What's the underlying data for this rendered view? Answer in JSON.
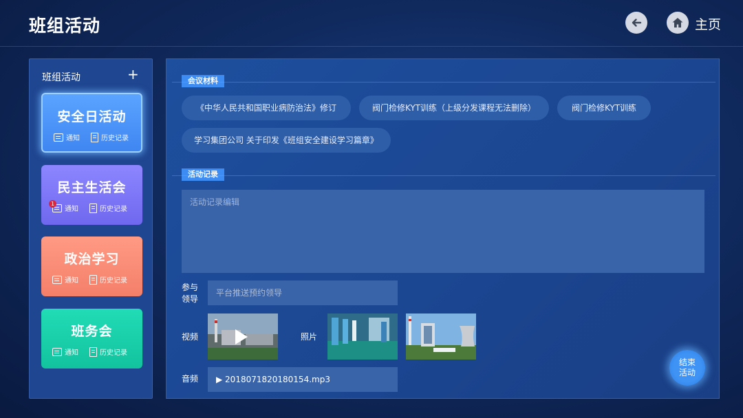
{
  "header": {
    "title": "班组活动",
    "home_label": "主页"
  },
  "sidebar": {
    "title": "班组活动",
    "add_symbol": "+",
    "cards": [
      {
        "title": "安全日活动",
        "notice": "通知",
        "history": "历史记录",
        "badge": ""
      },
      {
        "title": "民主生活会",
        "notice": "通知",
        "history": "历史记录",
        "badge": "1"
      },
      {
        "title": "政治学习",
        "notice": "通知",
        "history": "历史记录",
        "badge": ""
      },
      {
        "title": "班务会",
        "notice": "通知",
        "history": "历史记录",
        "badge": ""
      }
    ]
  },
  "main": {
    "materials_tag": "会议材料",
    "materials": [
      "《中华人民共和国职业病防治法》修订",
      "阀门检修KYT训练（上级分发课程无法删除）",
      "阀门检修KYT训练",
      "学习集团公司 关于印发《班组安全建设学习篇章》"
    ],
    "record_tag": "活动记录",
    "record_placeholder": "活动记录编辑",
    "leader_label": "参与\n领导",
    "leader_placeholder": "平台推送预约领导",
    "video_label": "视频",
    "photo_label": "照片",
    "audio_label": "音频",
    "audio_file": "▶ 2018071820180154.mp3",
    "end_button": "结束活动"
  },
  "colors": {
    "accent": "#3c8cf3",
    "card_safety": "#4f97fb",
    "card_democratic": "#7f78f8",
    "card_political": "#f98d77",
    "card_team": "#18cfaa",
    "badge": "#e0243a"
  }
}
